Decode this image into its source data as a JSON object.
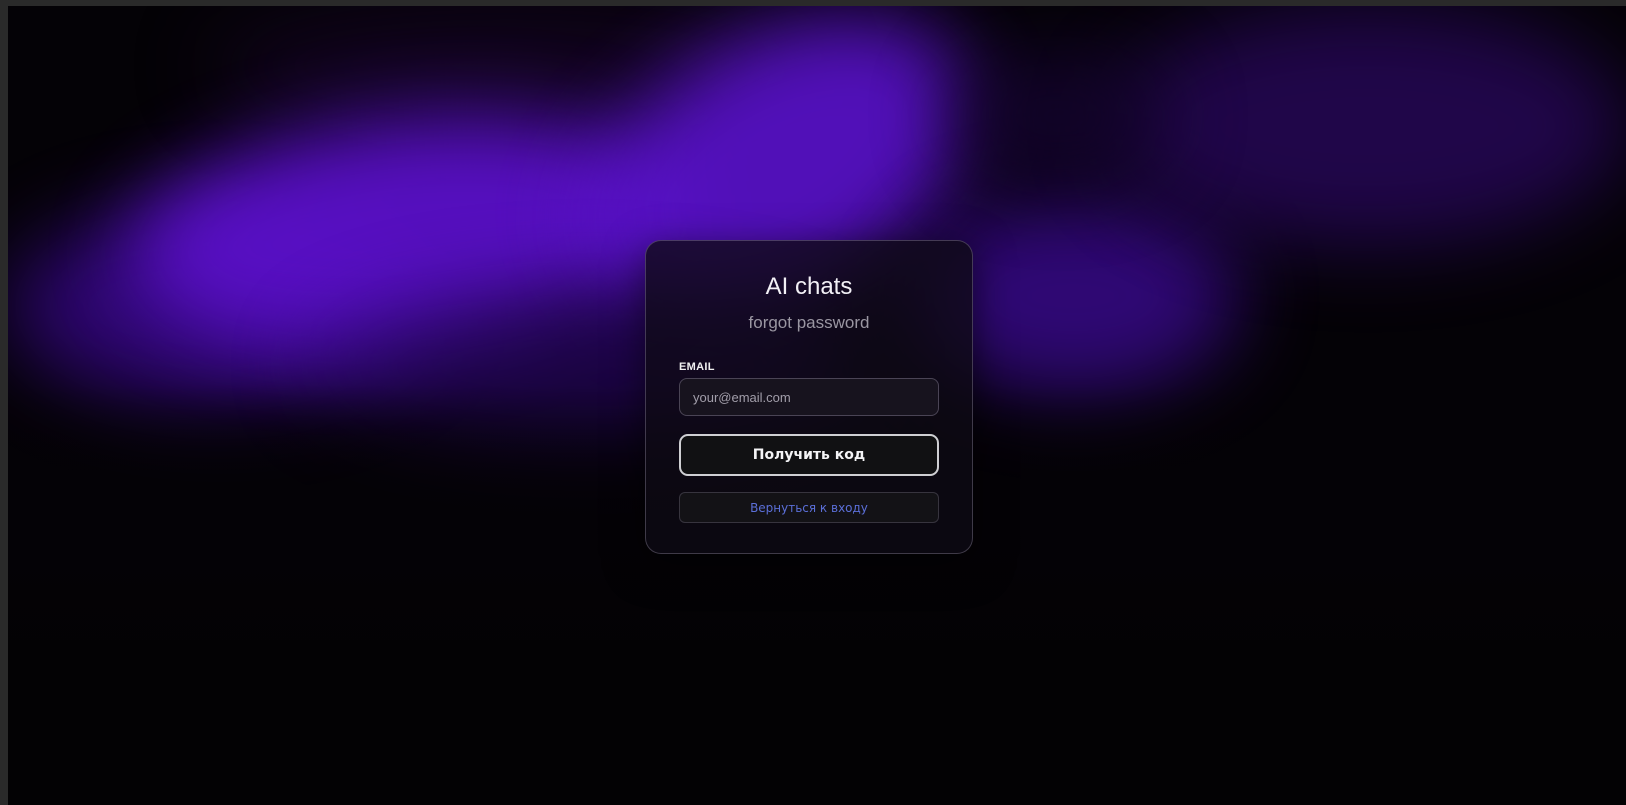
{
  "app": {
    "title": "AI chats",
    "subtitle": "forgot password"
  },
  "form": {
    "email_label": "EMAIL",
    "email_placeholder": "your@email.com",
    "email_value": "",
    "submit_label": "Получить код",
    "back_label": "Вернуться к входу"
  },
  "colors": {
    "background": "#040206",
    "aurora_purple": "#5a10c8",
    "card_border": "#cfcfd3",
    "link_blue": "#5b6fd8"
  }
}
